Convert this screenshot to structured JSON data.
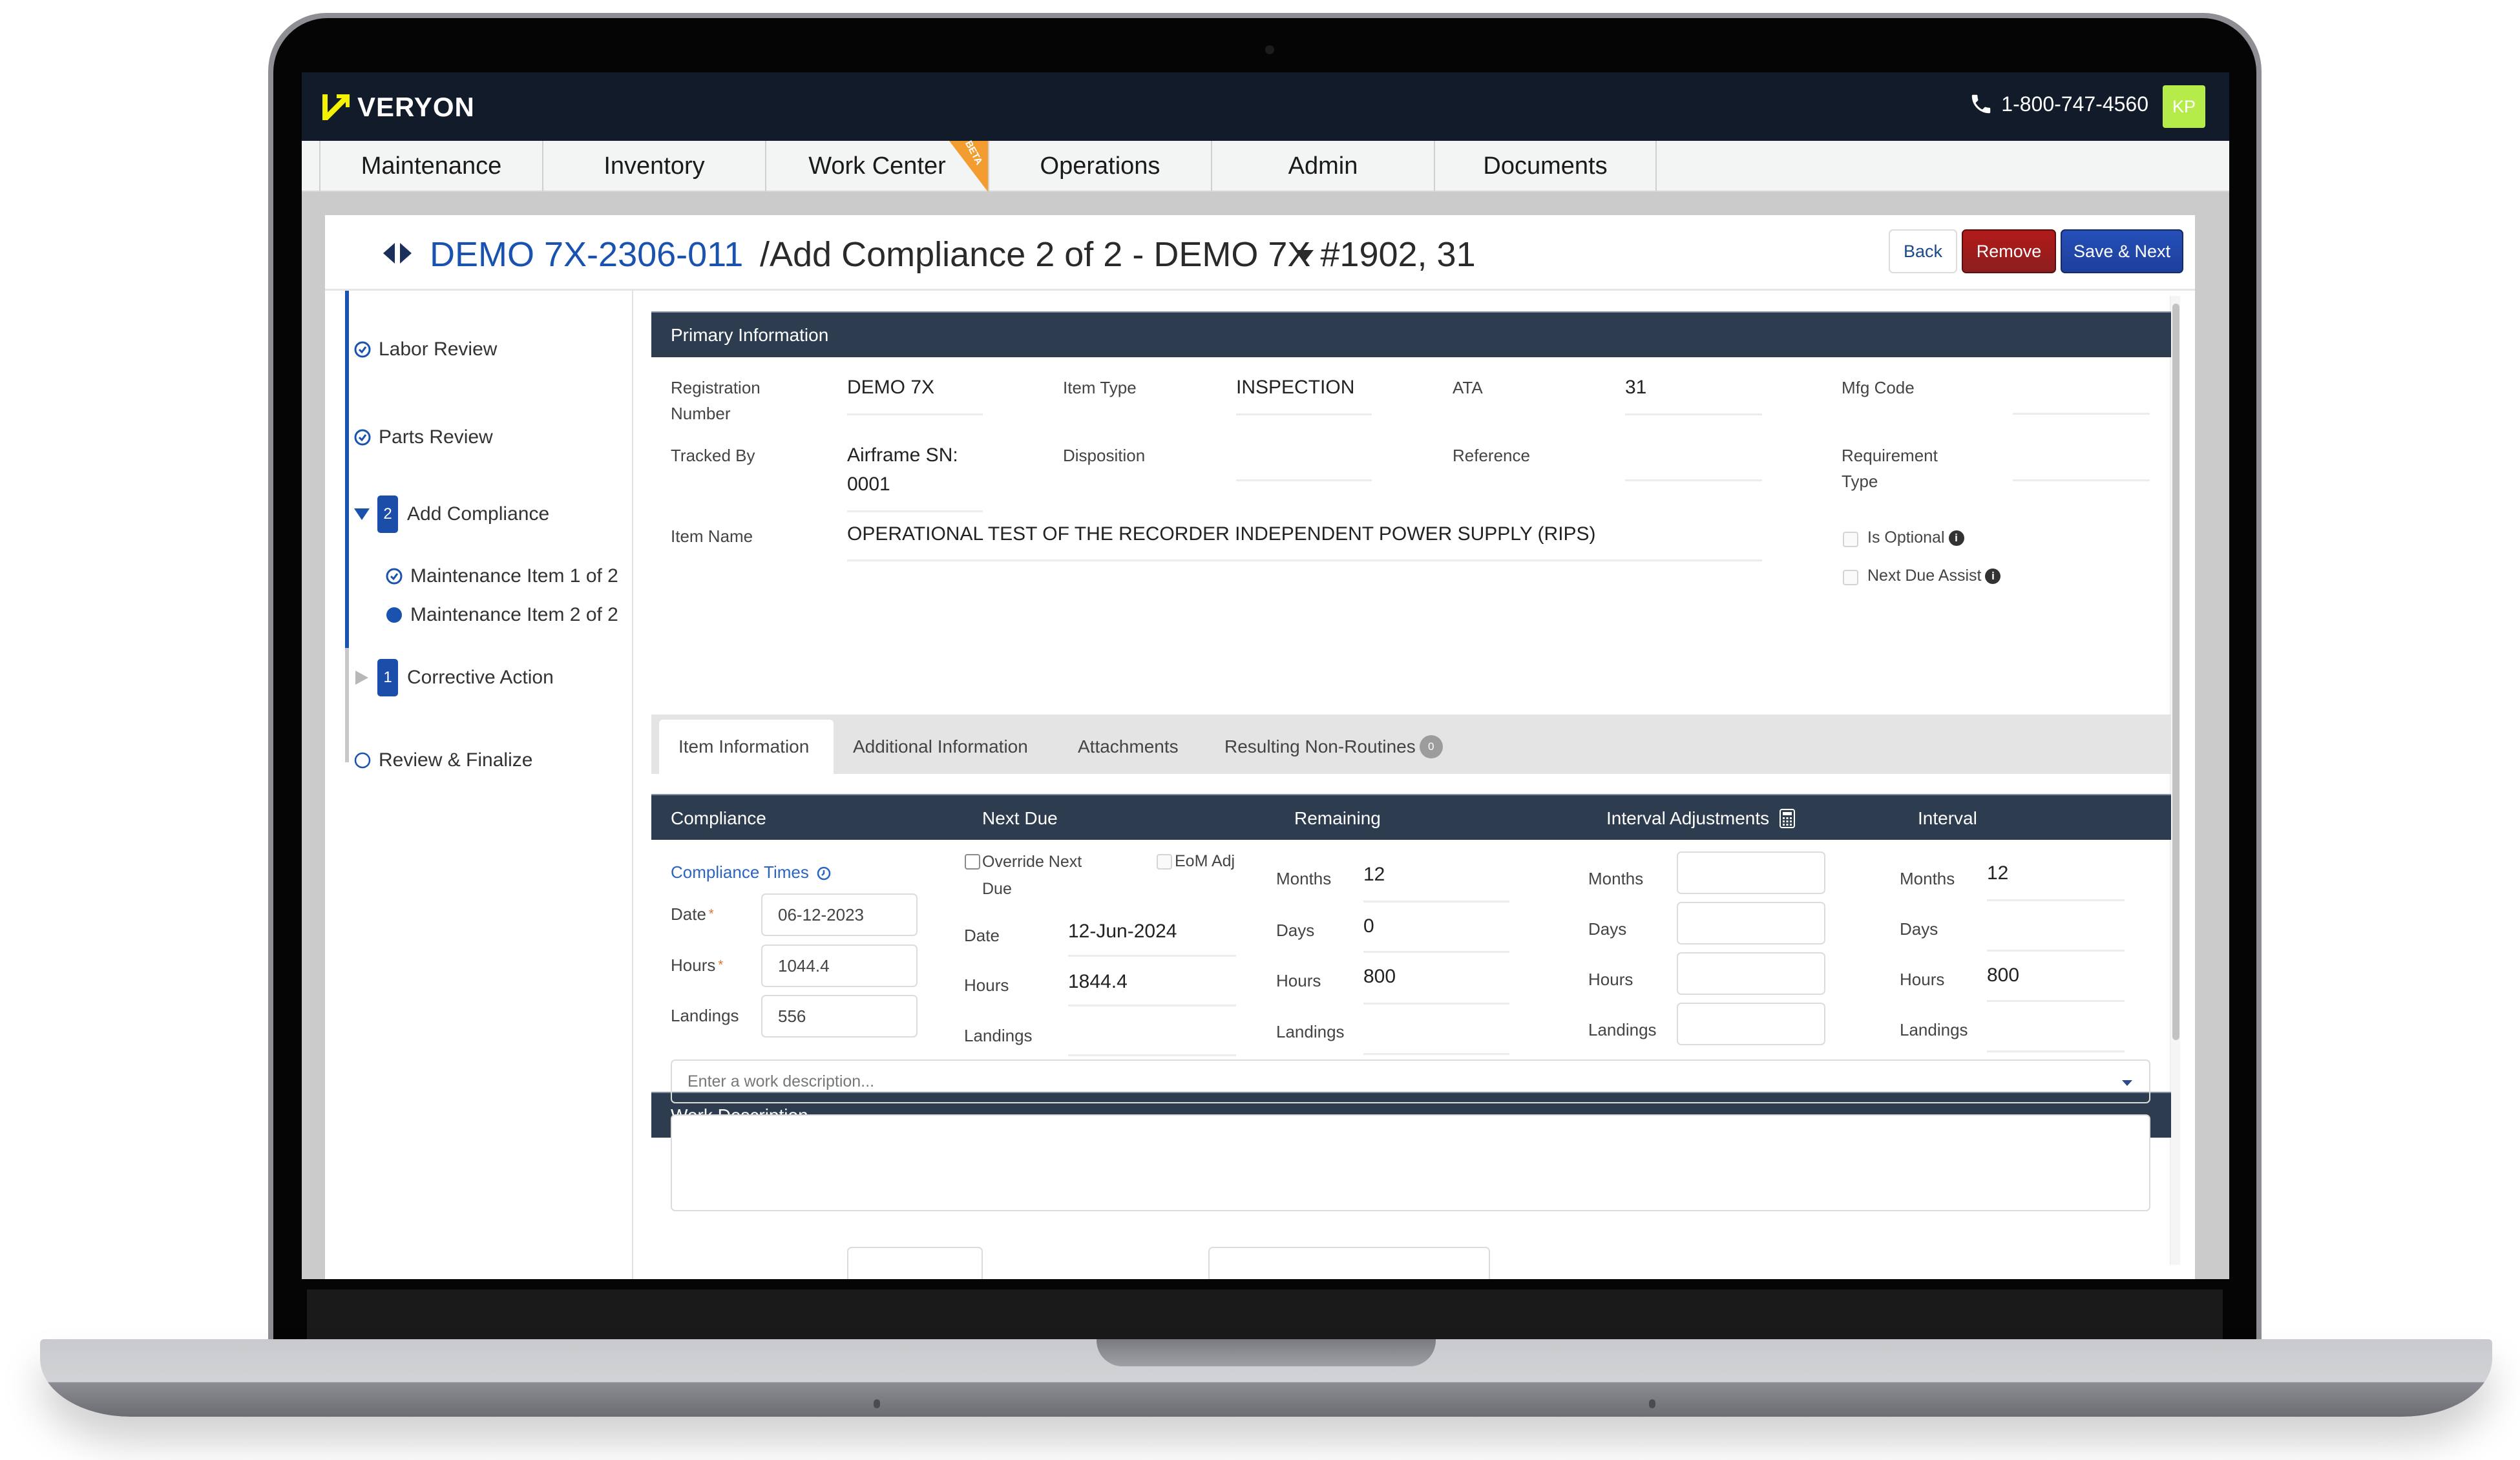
{
  "header": {
    "brand": "VERYON",
    "phone": "1-800-747-4560",
    "user_initials": "KP",
    "brand_color": "#111b2a",
    "logo_accent": "#f4f200",
    "avatar_color": "#b5ec4a"
  },
  "nav": {
    "tabs": [
      {
        "label": "Maintenance"
      },
      {
        "label": "Inventory"
      },
      {
        "label": "Work Center",
        "badge": "BETA"
      },
      {
        "label": "Operations"
      },
      {
        "label": "Admin"
      },
      {
        "label": "Documents"
      }
    ]
  },
  "page": {
    "record_link": "DEMO 7X-2306-011",
    "title_rest": "/Add Compliance 2 of 2 - DEMO 7X #1902, 31",
    "buttons": {
      "back": "Back",
      "remove": "Remove",
      "save_next": "Save & Next"
    }
  },
  "steps": [
    {
      "label": "Labor Review",
      "status": "complete"
    },
    {
      "label": "Parts Review",
      "status": "complete"
    },
    {
      "label": "Add Compliance",
      "count": "2",
      "status": "expanded"
    },
    {
      "label": "Maintenance Item 1 of 2",
      "status": "complete"
    },
    {
      "label": "Maintenance Item 2 of 2",
      "status": "current"
    },
    {
      "label": "Corrective Action",
      "count": "1",
      "status": "collapsed"
    },
    {
      "label": "Review & Finalize",
      "status": "pending"
    }
  ],
  "primary": {
    "heading": "Primary Information",
    "registration_number_label": "Registration Number",
    "registration_number": "DEMO 7X",
    "item_type_label": "Item Type",
    "item_type": "INSPECTION",
    "ata_label": "ATA",
    "ata": "31",
    "mfg_code_label": "Mfg Code",
    "mfg_code": "",
    "tracked_by_label": "Tracked By",
    "tracked_by_line1": "Airframe SN:",
    "tracked_by_line2": "0001",
    "disposition_label": "Disposition",
    "disposition": "",
    "reference_label": "Reference",
    "reference": "",
    "requirement_type_label": "Requirement Type",
    "requirement_type": "",
    "item_name_label": "Item Name",
    "item_name": "OPERATIONAL TEST OF THE RECORDER INDEPENDENT POWER SUPPLY (RIPS)",
    "is_optional_label": "Is Optional",
    "is_optional": false,
    "next_due_assist_label": "Next Due Assist",
    "next_due_assist": false
  },
  "tabs": [
    {
      "label": "Item Information",
      "active": true
    },
    {
      "label": "Additional Information"
    },
    {
      "label": "Attachments"
    },
    {
      "label": "Resulting Non-Routines",
      "count": "0"
    }
  ],
  "columns": {
    "compliance": "Compliance",
    "next_due": "Next Due",
    "remaining": "Remaining",
    "interval_adjustments": "Interval Adjustments",
    "interval": "Interval"
  },
  "compliance": {
    "times_link": "Compliance Times",
    "date_label": "Date",
    "date": "06-12-2023",
    "hours_label": "Hours",
    "hours": "1044.4",
    "landings_label": "Landings",
    "landings": "556"
  },
  "next_due": {
    "override_label": "Override Next Due",
    "override": false,
    "eom_label": "EoM Adj",
    "eom": false,
    "date_label": "Date",
    "date": "12-Jun-2024",
    "hours_label": "Hours",
    "hours": "1844.4",
    "landings_label": "Landings",
    "landings": ""
  },
  "remaining": {
    "months_label": "Months",
    "months": "12",
    "days_label": "Days",
    "days": "0",
    "hours_label": "Hours",
    "hours": "800",
    "landings_label": "Landings",
    "landings": ""
  },
  "interval_adjustments": {
    "months_label": "Months",
    "months": "",
    "days_label": "Days",
    "days": "",
    "hours_label": "Hours",
    "hours": "",
    "landings_label": "Landings",
    "landings": ""
  },
  "interval": {
    "months_label": "Months",
    "months": "12",
    "days_label": "Days",
    "days": "",
    "hours_label": "Hours",
    "hours": "800",
    "landings_label": "Landings",
    "landings": ""
  },
  "work_description": {
    "heading": "Work Description",
    "placeholder": "Enter a work description...",
    "text": ""
  }
}
